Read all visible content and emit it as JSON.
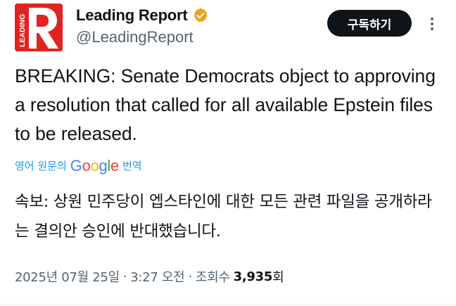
{
  "account": {
    "display_name": "Leading Report",
    "handle": "@LeadingReport",
    "verified": true,
    "avatar_logo_text": "LEADING",
    "avatar_color": "#e0231f",
    "verified_color": "#e8a317"
  },
  "header": {
    "subscribe_label": "구독하기",
    "more_icon": "more-options-icon"
  },
  "tweet": {
    "text": "BREAKING: Senate Democrats object to approving a resolution that called for all available Epstein files to be released.",
    "translate": {
      "prefix": "영어 원문의",
      "google": [
        "G",
        "o",
        "o",
        "g",
        "l",
        "e"
      ],
      "suffix": "번역"
    },
    "translated_text": "속보: 상원 민주당이 엡스타인에 대한 모든 관련 파일을 공개하라는 결의안 승인에 반대했습니다."
  },
  "meta": {
    "date": "2025년 07월 25일",
    "separator": "·",
    "time": "3:27 오전",
    "views_label": "조회수",
    "views_count": "3,935",
    "views_unit": "회"
  },
  "colors": {
    "link": "#1d9bf0",
    "secondary_text": "#536471",
    "primary_text": "#0f1419"
  }
}
